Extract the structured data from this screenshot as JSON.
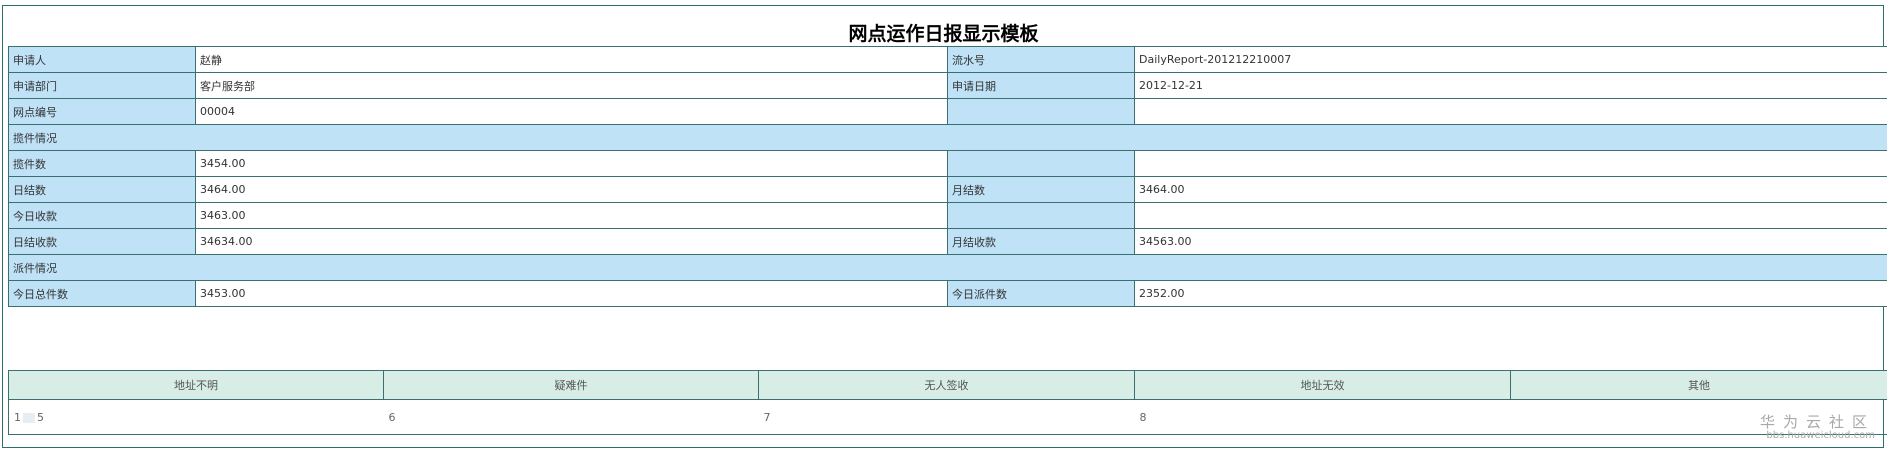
{
  "title": "网点运作日报显示模板",
  "rows": [
    {
      "l1": "申请人",
      "v1": "赵静",
      "l2": "流水号",
      "v2": "DailyReport-201212210007"
    },
    {
      "l1": "申请部门",
      "v1": "客户服务部",
      "l2": "申请日期",
      "v2": "2012-12-21"
    },
    {
      "l1": "网点编号",
      "v1": "00004",
      "l2": "",
      "v2": ""
    }
  ],
  "section1": "揽件情况",
  "rows2": [
    {
      "l1": "揽件数",
      "v1": "3454.00",
      "l2": "",
      "v2": ""
    },
    {
      "l1": "日结数",
      "v1": "3464.00",
      "l2": "月结数",
      "v2": "3464.00"
    },
    {
      "l1": "今日收款",
      "v1": "3463.00",
      "l2": "",
      "v2": ""
    },
    {
      "l1": "日结收款",
      "v1": "34634.00",
      "l2": "月结收款",
      "v2": "34563.00"
    }
  ],
  "section2": "派件情况",
  "rows3": [
    {
      "l1": "今日总件数",
      "v1": "3453.00",
      "l2": "今日派件数",
      "v2": "2352.00"
    }
  ],
  "bottom": {
    "headers": [
      "地址不明",
      "疑难件",
      "无人签收",
      "地址无效",
      "其他"
    ],
    "values": [
      "1",
      "5",
      "6",
      "7",
      "8",
      ""
    ]
  },
  "watermark": {
    "cn": "华为云社区",
    "en": "bbs.huaweicloud.com"
  }
}
